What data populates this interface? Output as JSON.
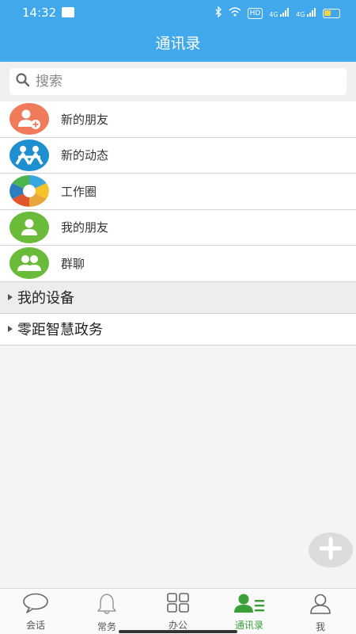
{
  "status_bar": {
    "time": "14:32",
    "hd": "HD",
    "signal1": "4G",
    "signal2": "4G"
  },
  "header": {
    "title": "通讯录"
  },
  "search": {
    "placeholder": "搜索",
    "value": ""
  },
  "contacts": [
    {
      "label": "新的朋友",
      "icon": "new-friend-icon",
      "color": "#f07b5a"
    },
    {
      "label": "新的动态",
      "icon": "news-feed-icon",
      "color": "#1e8fd0"
    },
    {
      "label": "工作圈",
      "icon": "work-circle-icon",
      "color": "#ffffff"
    },
    {
      "label": "我的朋友",
      "icon": "my-friends-icon",
      "color": "#6bbb3a"
    },
    {
      "label": "群聊",
      "icon": "group-chat-icon",
      "color": "#6bbb3a"
    }
  ],
  "groups": [
    {
      "label": "我的设备"
    },
    {
      "label": "零距智慧政务"
    }
  ],
  "tabs": [
    {
      "label": "会话",
      "icon": "chat-bubble-icon"
    },
    {
      "label": "常务",
      "icon": "bell-icon"
    },
    {
      "label": "办公",
      "icon": "grid-icon"
    },
    {
      "label": "通讯录",
      "icon": "contacts-icon",
      "active": true
    },
    {
      "label": "我",
      "icon": "person-icon"
    }
  ],
  "colors": {
    "primary": "#41a8ec",
    "active_tab": "#3aa03a"
  }
}
